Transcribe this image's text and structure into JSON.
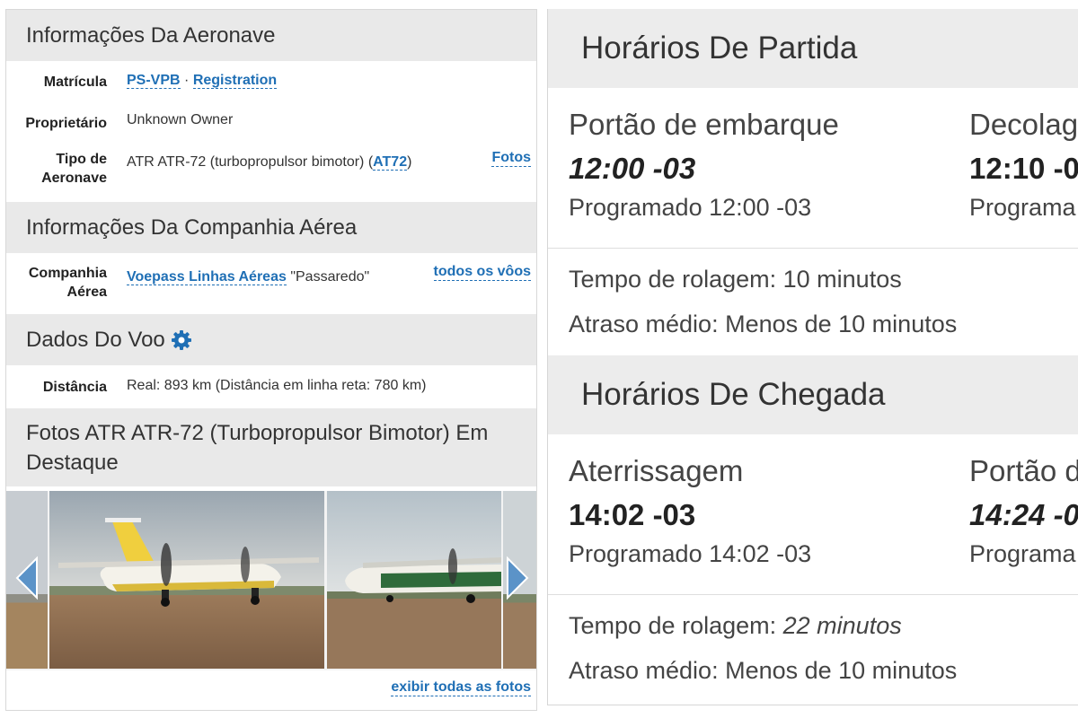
{
  "aircraft_info": {
    "header": "Informações Da Aeronave",
    "registration_label": "Matrícula",
    "registration_value": "PS-VPB",
    "registration_separator": "·",
    "registration_link": "Registration",
    "owner_label": "Proprietário",
    "owner_value": "Unknown Owner",
    "type_label_line1": "Tipo de",
    "type_label_line2": "Aeronave",
    "type_value": "ATR ATR-72 (turbopropulsor bimotor) (",
    "type_code": "AT72",
    "type_close": ")",
    "photos_link": "Fotos"
  },
  "airline_info": {
    "header": "Informações Da Companhia Aérea",
    "company_label_line1": "Companhia",
    "company_label_line2": "Aérea",
    "company_name": "Voepass Linhas Aéreas",
    "company_nickname": "\"Passaredo\"",
    "all_flights_link": "todos os vôos"
  },
  "flight_data": {
    "header": "Dados Do Voo",
    "distance_label": "Distância",
    "distance_value": "Real: 893 km (Distância em linha reta: 780 km)"
  },
  "photos": {
    "header_line1": "Fotos ATR ATR-72 (Turbopropulsor Bimotor) Em",
    "header_line2": "Destaque",
    "view_all_link": "exibir todas as fotos"
  },
  "departure": {
    "header": "Horários De Partida",
    "gate_label": "Portão de embarque",
    "gate_time": "12:00 -03",
    "gate_scheduled": "Programado 12:00 -03",
    "takeoff_label": "Decolag",
    "takeoff_time": "12:10 -0",
    "takeoff_scheduled": "Programa",
    "taxi_label": "Tempo de rolagem:",
    "taxi_value": "10 minutos",
    "avg_delay": "Atraso médio: Menos de 10 minutos"
  },
  "arrival": {
    "header": "Horários De Chegada",
    "landing_label": "Aterrissagem",
    "landing_time": "14:02 -03",
    "landing_scheduled": "Programado 14:02 -03",
    "gate_label": "Portão d",
    "gate_time": "14:24 -0",
    "gate_scheduled": "Programa",
    "taxi_label": "Tempo de rolagem:",
    "taxi_value": "22 minutos",
    "avg_delay": "Atraso médio: Menos de 10 minutos"
  },
  "colors": {
    "link": "#1f6fb5",
    "section_header_bg": "#e9e9e9",
    "gear_icon": "#1f6fb5"
  }
}
